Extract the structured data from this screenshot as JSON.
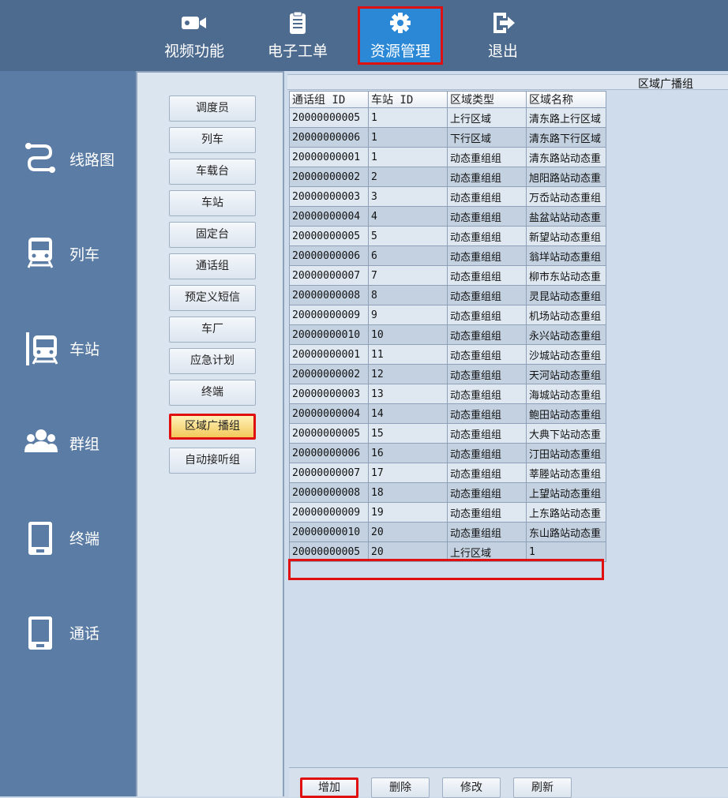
{
  "top_nav": [
    {
      "label": "视频功能",
      "icon": "video-camera-icon"
    },
    {
      "label": "电子工单",
      "icon": "clipboard-icon"
    },
    {
      "label": "资源管理",
      "icon": "gear-icon",
      "active": true
    },
    {
      "label": "退出",
      "icon": "logout-icon"
    }
  ],
  "sidebar": [
    {
      "label": "线路图",
      "icon": "route-icon"
    },
    {
      "label": "列车",
      "icon": "train-icon"
    },
    {
      "label": "车站",
      "icon": "station-icon"
    },
    {
      "label": "群组",
      "icon": "group-icon"
    },
    {
      "label": "终端",
      "icon": "terminal-icon"
    },
    {
      "label": "通话",
      "icon": "call-terminal-icon"
    }
  ],
  "sub_menu": [
    "调度员",
    "列车",
    "车载台",
    "车站",
    "固定台",
    "通话组",
    "预定义短信",
    "车厂",
    "应急计划",
    "终端",
    "区域广播组",
    "自动接听组"
  ],
  "sub_menu_active": "区域广播组",
  "panel": {
    "title": "区域广播组"
  },
  "table": {
    "columns": [
      "通话组 ID",
      "车站 ID",
      "区域类型",
      "区域名称"
    ],
    "rows": [
      [
        "20000000005",
        "1",
        "上行区域",
        "清东路上行区域"
      ],
      [
        "20000000006",
        "1",
        "下行区域",
        "清东路下行区域"
      ],
      [
        "20000000001",
        "1",
        "动态重组组",
        "清东路站动态重"
      ],
      [
        "20000000002",
        "2",
        "动态重组组",
        "旭阳路站动态重"
      ],
      [
        "20000000003",
        "3",
        "动态重组组",
        "万岙站动态重组"
      ],
      [
        "20000000004",
        "4",
        "动态重组组",
        "盐盆站站动态重"
      ],
      [
        "20000000005",
        "5",
        "动态重组组",
        "新望站动态重组"
      ],
      [
        "20000000006",
        "6",
        "动态重组组",
        "翁垟站动态重组"
      ],
      [
        "20000000007",
        "7",
        "动态重组组",
        "柳市东站动态重"
      ],
      [
        "20000000008",
        "8",
        "动态重组组",
        "灵昆站动态重组"
      ],
      [
        "20000000009",
        "9",
        "动态重组组",
        "机场站动态重组"
      ],
      [
        "20000000010",
        "10",
        "动态重组组",
        "永兴站动态重组"
      ],
      [
        "20000000001",
        "11",
        "动态重组组",
        "沙城站动态重组"
      ],
      [
        "20000000002",
        "12",
        "动态重组组",
        "天河站动态重组"
      ],
      [
        "20000000003",
        "13",
        "动态重组组",
        "海城站动态重组"
      ],
      [
        "20000000004",
        "14",
        "动态重组组",
        "鲍田站动态重组"
      ],
      [
        "20000000005",
        "15",
        "动态重组组",
        "大典下站动态重"
      ],
      [
        "20000000006",
        "16",
        "动态重组组",
        "汀田站动态重组"
      ],
      [
        "20000000007",
        "17",
        "动态重组组",
        "莘塍站动态重组"
      ],
      [
        "20000000008",
        "18",
        "动态重组组",
        "上望站动态重组"
      ],
      [
        "20000000009",
        "19",
        "动态重组组",
        "上东路站动态重"
      ],
      [
        "20000000010",
        "20",
        "动态重组组",
        "东山路站动态重"
      ]
    ],
    "new_row": [
      "20000000005",
      "20",
      "上行区域",
      "1"
    ]
  },
  "actions": [
    "增加",
    "删除",
    "修改",
    "刷新"
  ],
  "colors": {
    "highlight": "#e01010",
    "topbar": "#4d6a8f",
    "sidebar": "#5b7ca4",
    "active_tab": "#2a88d6"
  }
}
